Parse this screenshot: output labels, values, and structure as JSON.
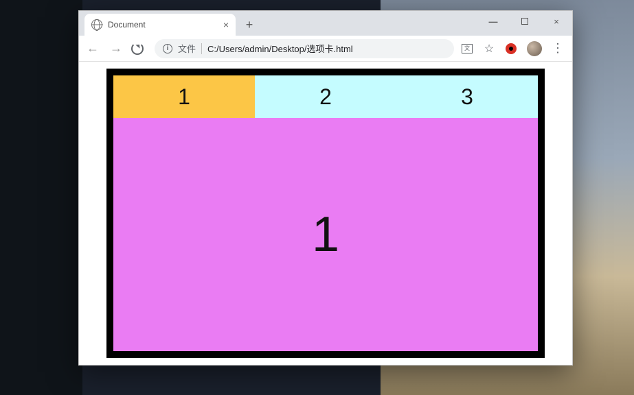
{
  "browser": {
    "tab_title": "Document",
    "new_tab_tooltip": "New tab",
    "window_controls": {
      "minimize": "—",
      "close": "×"
    },
    "nav": {
      "back": "←",
      "forward": "→"
    },
    "omnibox": {
      "security_label": "文件",
      "url": "C:/Users/admin/Desktop/选项卡.html"
    },
    "menu_glyph": "⋮"
  },
  "page": {
    "tabs": [
      {
        "label": "1",
        "active": true
      },
      {
        "label": "2",
        "active": false
      },
      {
        "label": "3",
        "active": false
      }
    ],
    "panel_content": "1"
  },
  "colors": {
    "tab_active": "#fcc646",
    "tab_inactive": "#c5fcff",
    "panel": "#ea7cf3",
    "card_border": "#000000"
  }
}
